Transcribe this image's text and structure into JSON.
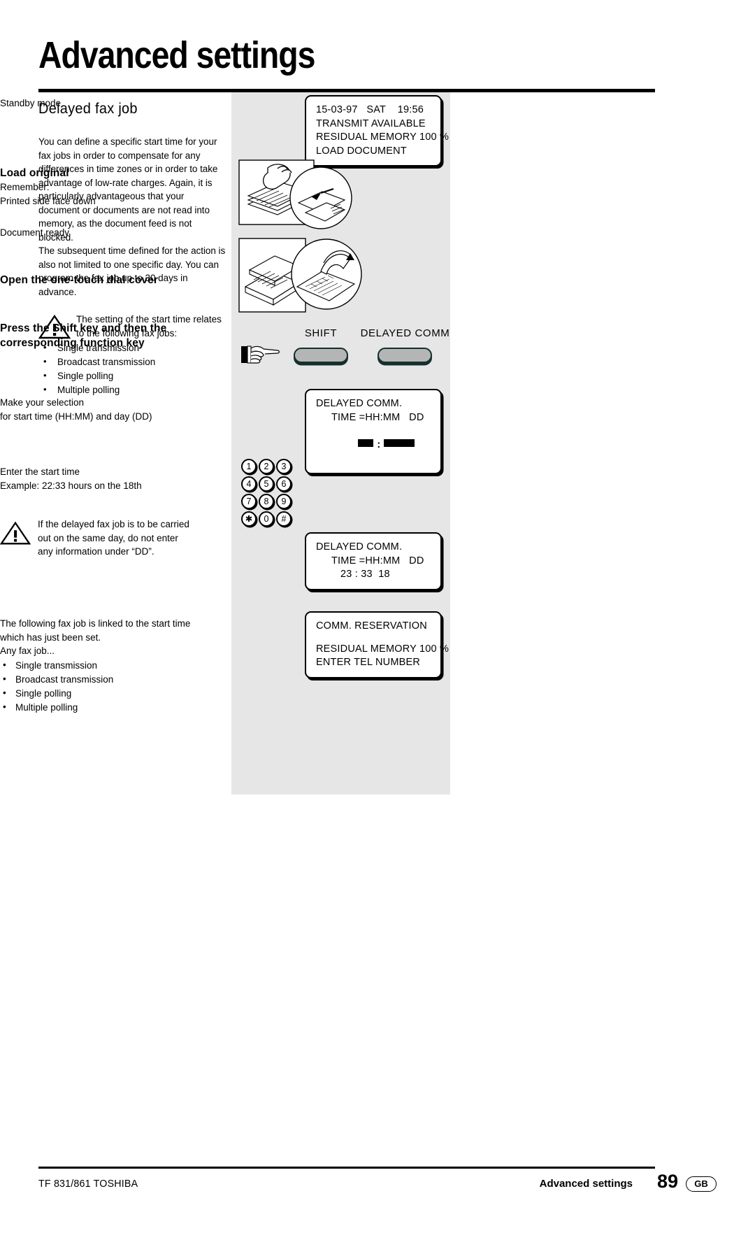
{
  "header": {
    "title": "Advanced settings"
  },
  "left": {
    "section_title": "Delayed fax job",
    "paragraph1": "You can define a specific start time for your fax jobs in order to compensate for any differences in time zones or in order to take advantage of low-rate charges. Again, it is particularly advantageous that your document or documents are not read into memory, as the document feed is not blocked.",
    "paragraph2": "The subsequent time defined for the action is also not limited to one specific day. You can program the fax job up to 30 days in advance.",
    "warning": "The setting of the start time relates to the following fax jobs:",
    "bullets": [
      "Single transmission",
      "Broadcast transmission",
      "Single polling",
      "Multiple polling"
    ]
  },
  "middle": {
    "lcd1": {
      "line1": "15-03-97   SAT    19:56",
      "line2": "TRANSMIT AVAILABLE",
      "line3": "RESIDUAL MEMORY 100 %",
      "line4": "LOAD DOCUMENT"
    },
    "keys": {
      "shift_label": "SHIFT",
      "delayed_label": "DELAYED COMM"
    },
    "lcd2": {
      "line1": "DELAYED COMM.",
      "line2": "TIME =HH:MM   DD",
      "line3_desc": "cursor blocks"
    },
    "keypad": [
      "1",
      "2",
      "3",
      "4",
      "5",
      "6",
      "7",
      "8",
      "9",
      "✱",
      "0",
      "#"
    ],
    "lcd3": {
      "line1": "DELAYED COMM.",
      "line2": "TIME =HH:MM   DD",
      "line3": "23 : 33  18"
    },
    "lcd4": {
      "line1": "COMM. RESERVATION",
      "line2": "RESIDUAL MEMORY 100 %",
      "line3": "ENTER TEL NUMBER"
    }
  },
  "right": {
    "standby": "Standby mode",
    "load_original_head": "Load original",
    "load_original_l1": "Remember:",
    "load_original_l2": "Printed side face down",
    "document_ready": "Document ready",
    "open_cover_head": "Open the one-touch dial cover",
    "press_shift_head": "Press the Shift key and then the corresponding function key",
    "selection_l1": "Make your selection",
    "selection_l2": "for start time (HH:MM) and day (DD)",
    "enter_l1": "Enter the start time",
    "enter_l2": "Example: 22:33 hours on the 18th",
    "note": "If the delayed fax job is to be carried out on the same day, do not enter any information under “DD”.",
    "linked_l1": "The following fax job is linked to the start time which has just been set.",
    "linked_l2": "Any fax job...",
    "bullets": [
      "Single transmission",
      "Broadcast transmission",
      "Single polling",
      "Multiple polling"
    ]
  },
  "footer": {
    "left": "TF 831/861 TOSHIBA",
    "section": "Advanced settings",
    "page": "89",
    "locale": "GB"
  }
}
